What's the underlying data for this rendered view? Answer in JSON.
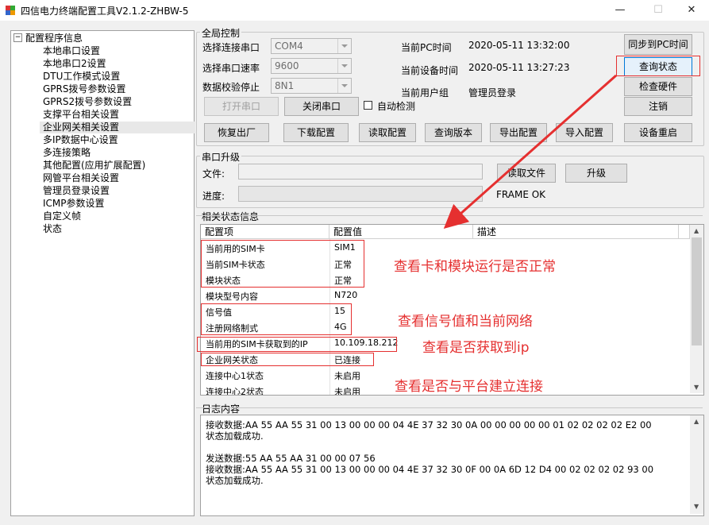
{
  "window": {
    "title": "四信电力终端配置工具V2.1.2-ZHBW-5",
    "min": "—",
    "max": "☐",
    "close": "✕"
  },
  "tree": {
    "root": "配置程序信息",
    "items": [
      "本地串口设置",
      "本地串口2设置",
      "DTU工作模式设置",
      "GPRS拨号参数设置",
      "GPRS2拨号参数设置",
      "支撑平台相关设置",
      "企业网关相关设置",
      "多IP数据中心设置",
      "多连接策略",
      "其他配置(应用扩展配置)",
      "网管平台相关设置",
      "管理员登录设置",
      "ICMP参数设置",
      "自定义帧",
      "状态"
    ],
    "selected_index": 6
  },
  "global": {
    "title": "全局控制",
    "port_label": "选择连接串口",
    "port_value": "COM4",
    "baud_label": "选择串口速率",
    "baud_value": "9600",
    "parity_label": "数据校验停止",
    "parity_value": "8N1",
    "pc_time_label": "当前PC时间",
    "pc_time": "2020-05-11  13:32:00",
    "dev_time_label": "当前设备时间",
    "dev_time": "2020-05-11  13:27:23",
    "user_label": "当前用户组",
    "user": "管理员登录",
    "sync_btn": "同步到PC时间",
    "query_btn": "查询状态",
    "check_hw_btn": "检查硬件",
    "logout_btn": "注销",
    "open_btn": "打开串口",
    "close_btn": "关闭串口",
    "auto_detect": "自动检测",
    "restore_btn": "恢复出厂",
    "download_btn": "下载配置",
    "read_btn": "读取配置",
    "version_btn": "查询版本",
    "export_btn": "导出配置",
    "import_btn": "导入配置",
    "reboot_btn": "设备重启"
  },
  "upgrade": {
    "title": "串口升级",
    "file_label": "文件:",
    "progress_label": "进度:",
    "read_file_btn": "读取文件",
    "upgrade_btn": "升级",
    "status": "FRAME OK"
  },
  "status": {
    "title": "相关状态信息",
    "columns": [
      "配置项",
      "配置值",
      "描述"
    ],
    "rows": [
      [
        "当前用的SIM卡",
        "SIM1"
      ],
      [
        "当前SIM卡状态",
        "正常"
      ],
      [
        "模块状态",
        "正常"
      ],
      [
        "模块型号内容",
        "N720"
      ],
      [
        "信号值",
        "15"
      ],
      [
        "注册网络制式",
        "4G"
      ],
      [
        "当前用的SIM卡获取到的IP",
        "10.109.18.212"
      ],
      [
        "企业网关状态",
        "已连接"
      ],
      [
        "连接中心1状态",
        "未启用"
      ],
      [
        "连接中心2状态",
        "未启用"
      ]
    ]
  },
  "annotations": [
    "查看卡和模块运行是否正常",
    "查看信号值和当前网络",
    "查看是否获取到ip",
    "查看是否与平台建立连接"
  ],
  "log": {
    "title": "日志内容",
    "lines": [
      "接收数据:AA 55 AA 55 31 00 13 00 00 00 04 4E 37 32 30 0A 00 00 00 00 00 01 02 02 02 02 E2 00",
      "状态加载成功.",
      "",
      "发送数据:55 AA 55 AA 31 00 00 07 56",
      "接收数据:AA 55 AA 55 31 00 13 00 00 00 04 4E 37 32 30 0F 00 0A 6D 12 D4 00 02 02 02 02 93 00",
      "状态加载成功."
    ]
  },
  "colors": {
    "accent": "#e53030",
    "focus": "#0078d7"
  }
}
